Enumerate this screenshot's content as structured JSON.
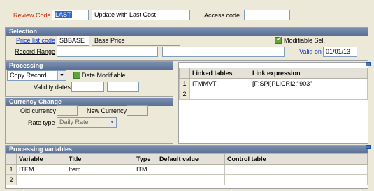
{
  "header": {
    "review_code_label": "Review Code",
    "review_code_value": "LAST",
    "review_description": "Update with Last Cost",
    "access_code_label": "Access code",
    "access_code_value": ""
  },
  "selection": {
    "title": "Selection",
    "price_list_code_label": "Price list code",
    "price_list_code_value": "SBBASE",
    "price_list_description": "Base Price",
    "modifiable_sel_label": "Modifiable Sel.",
    "record_range_label": "Record Range",
    "record_range_from": "",
    "record_range_to": "",
    "valid_on_label": "Valid on",
    "valid_on_value": "01/01/13"
  },
  "processing": {
    "title": "Processing",
    "mode_value": "Copy Record",
    "date_modifiable_label": "Date Modifiable",
    "validity_dates_label": "Validity dates",
    "validity_from": "",
    "validity_to": ""
  },
  "linked_tables": {
    "columns": [
      "Linked tables",
      "Link expression"
    ],
    "rows": [
      {
        "num": "1",
        "table": "ITMMVT",
        "expression": "[F:SPI]PLICRI2;\"903\""
      },
      {
        "num": "2",
        "table": "",
        "expression": ""
      }
    ]
  },
  "currency_change": {
    "title": "Currency Change",
    "old_currency_label": "Old currency",
    "old_currency_value": "",
    "new_currency_label": "New Currency",
    "new_currency_value": "",
    "rate_type_label": "Rate type",
    "rate_type_value": "Daily Rate"
  },
  "processing_variables": {
    "title": "Processing variables",
    "columns": [
      "Variable",
      "Title",
      "Type",
      "Default value",
      "Control table"
    ],
    "rows": [
      {
        "num": "1",
        "variable": "ITEM",
        "title": "Item",
        "type": "ITM",
        "default_value": "",
        "control_table": ""
      },
      {
        "num": "2",
        "variable": "",
        "title": "",
        "type": "",
        "default_value": "",
        "control_table": ""
      }
    ]
  },
  "colors": {
    "section_header": "#5b6f93",
    "label_red": "#cc2200",
    "label_blue": "#1133cc",
    "window_bg": "#ece9d8"
  }
}
